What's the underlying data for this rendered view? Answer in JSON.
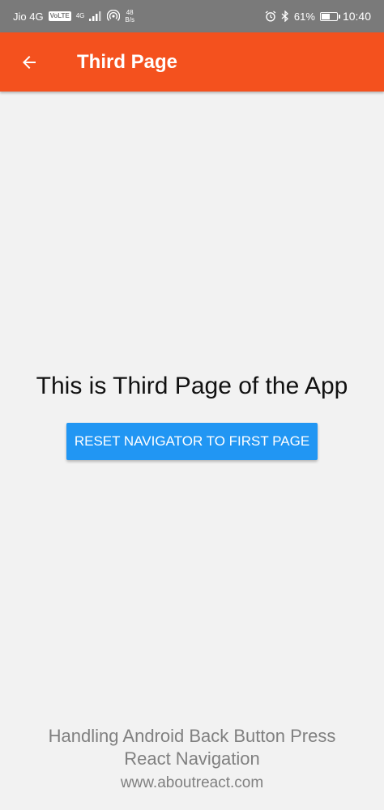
{
  "status_bar": {
    "carrier": "Jio 4G",
    "volte": "VoLTE",
    "net_gen": "4G",
    "speed_value": "48",
    "speed_unit": "B/s",
    "battery_percent": "61%",
    "battery_level": 0.61,
    "time": "10:40"
  },
  "header": {
    "title": "Third Page"
  },
  "main": {
    "message": "This is Third Page of the App",
    "reset_button_label": "RESET NAVIGATOR TO FIRST PAGE"
  },
  "footer": {
    "line1": "Handling Android Back Button Press",
    "line2": "React Navigation",
    "line3": "www.aboutreact.com"
  },
  "colors": {
    "app_bar": "#f4511e",
    "button": "#2196f3",
    "background": "#f2f2f2",
    "status_bar": "#7a7a7a"
  }
}
